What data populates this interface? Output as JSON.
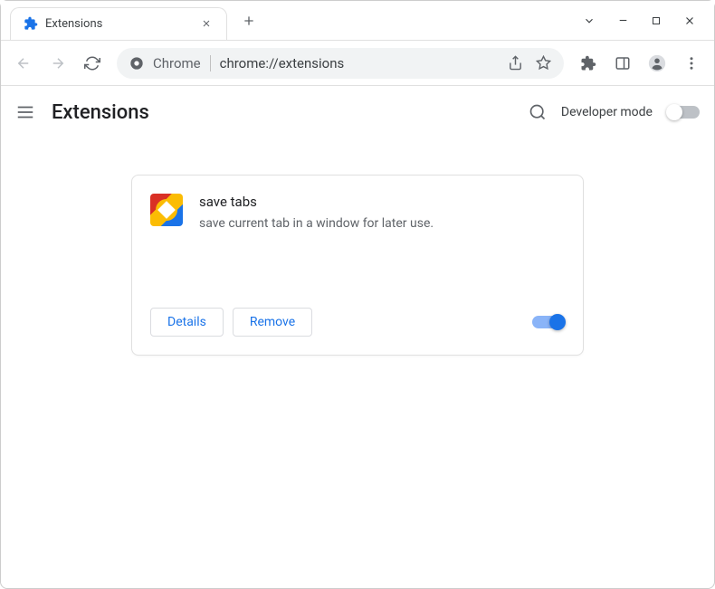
{
  "tab": {
    "title": "Extensions"
  },
  "omnibox": {
    "scheme_label": "Chrome",
    "url": "chrome://extensions"
  },
  "header": {
    "title": "Extensions",
    "dev_mode_label": "Developer mode"
  },
  "extension": {
    "name": "save tabs",
    "description": "save current tab in a window for later use.",
    "details_label": "Details",
    "remove_label": "Remove"
  }
}
